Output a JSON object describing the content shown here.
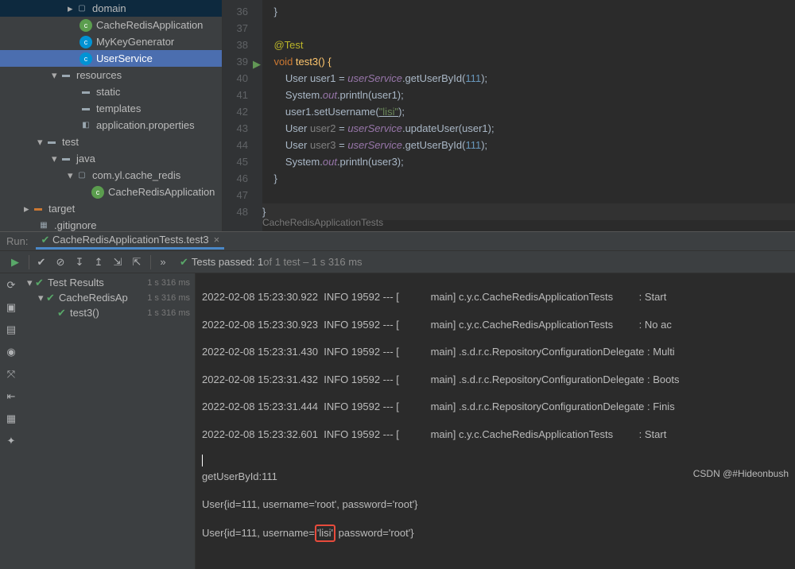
{
  "tree": {
    "domain": "domain",
    "cacheApp": "CacheRedisApplication",
    "keyGen": "MyKeyGenerator",
    "userSvc": "UserService",
    "resources": "resources",
    "static": "static",
    "templates": "templates",
    "appProps": "application.properties",
    "test": "test",
    "java": "java",
    "testPkg": "com.yl.cache_redis",
    "testApp": "CacheRedisApplication",
    "target": "target",
    "gitignore": ".gitignore"
  },
  "gutter": [
    "36",
    "37",
    "38",
    "39",
    "40",
    "41",
    "42",
    "43",
    "44",
    "45",
    "46",
    "47",
    "48"
  ],
  "code": {
    "l36": "    }",
    "l37": "",
    "l38": {
      "ann": "@Test"
    },
    "l39": {
      "kw": "void",
      "name": " test3() {"
    },
    "l40": {
      "pre": "        User user1 = ",
      "fld": "userService",
      "mid": ".getUserById(",
      "num": "111",
      "end": ");"
    },
    "l41": {
      "pre": "        System.",
      "out": "out",
      "p": ".println(user1);"
    },
    "l42": {
      "pre": "        user1.setUsername(",
      "str": "\"lisi\"",
      "end": ");"
    },
    "l43": {
      "pre": "        User ",
      "v": "user2",
      "eq": " = ",
      "fld": "userService",
      "mid": ".updateUser(user1);"
    },
    "l44": {
      "pre": "        User ",
      "v": "user3",
      "eq": " = ",
      "fld": "userService",
      "mid": ".getUserById(",
      "num": "111",
      "end": ");"
    },
    "l45": {
      "pre": "        System.",
      "out": "out",
      "p": ".println(user3);"
    },
    "l46": "    }",
    "l47": "",
    "l48": "}"
  },
  "breadcrumb": "CacheRedisApplicationTests",
  "run": {
    "label": "Run:",
    "tab": "CacheRedisApplicationTests.test3",
    "passed_a": "Tests passed: 1",
    "passed_b": " of 1 test – 1 s 316 ms"
  },
  "testTree": {
    "root": "Test Results",
    "rootTime": "1 s 316 ms",
    "cls": "CacheRedisAp",
    "clsTime": "1 s 316 ms",
    "m": "test3()",
    "mTime": "1 s 316 ms"
  },
  "console": [
    "2022-02-08 15:23:30.922  INFO 19592 --- [           main] c.y.c.CacheRedisApplicationTests         : Start",
    "2022-02-08 15:23:30.923  INFO 19592 --- [           main] c.y.c.CacheRedisApplicationTests         : No ac",
    "2022-02-08 15:23:31.430  INFO 19592 --- [           main] .s.d.r.c.RepositoryConfigurationDelegate : Multi",
    "2022-02-08 15:23:31.432  INFO 19592 --- [           main] .s.d.r.c.RepositoryConfigurationDelegate : Boots",
    "2022-02-08 15:23:31.444  INFO 19592 --- [           main] .s.d.r.c.RepositoryConfigurationDelegate : Finis",
    "2022-02-08 15:23:32.601  INFO 19592 --- [           main] c.y.c.CacheRedisApplicationTests         : Start"
  ],
  "out": {
    "l1": "getUserById:111",
    "l2": "User{id=111, username='root', password='root'}",
    "l3a": "User{id=111, username=",
    "l3b": "'lisi'",
    "l3c": " password='root'}"
  },
  "watermark": "CSDN @#Hideonbush"
}
